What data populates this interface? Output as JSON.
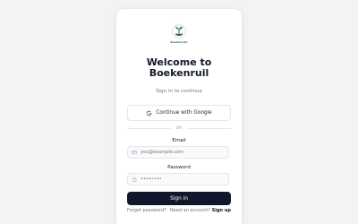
{
  "brand": {
    "logo_text": "Boekenruil",
    "title_line1": "Welcome to",
    "title_line2": "Boekenruil",
    "subtitle": "Sign in to continue"
  },
  "oauth": {
    "google_label": "Continue with Google",
    "icon": "google-icon"
  },
  "divider": {
    "label": "OR"
  },
  "form": {
    "email_label": "Email",
    "email_placeholder": "you@example.com",
    "email_icon": "mail-icon",
    "password_label": "Password",
    "password_value": "••••••••",
    "password_icon": "lock-icon",
    "submit_label": "Sign in"
  },
  "footer": {
    "forgot_label": "Forgot password?",
    "no_account_label": "Need an account?",
    "signup_label": "Sign up"
  },
  "colors": {
    "page_background": "#f1f3f5",
    "card_background": "#ffffff",
    "primary_button": "#0f172a",
    "logo_green": "#2f5a3c"
  }
}
